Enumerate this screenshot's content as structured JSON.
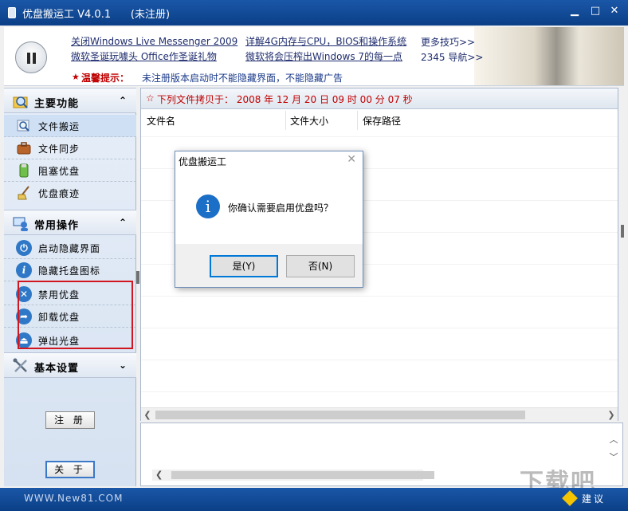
{
  "window": {
    "title": "优盘搬运工 V4.0.1      (未注册)",
    "minimize": "▁",
    "maximize": "□",
    "close": "✕"
  },
  "header": {
    "links": [
      {
        "text": "关闭Windows Live Messenger 2009"
      },
      {
        "text": "微软圣诞玩噱头 Office作圣诞礼物"
      },
      {
        "text": "详解4G内存与CPU，BIOS和操作系统"
      },
      {
        "text": "微软将会压榨出Windows 7的每一点"
      },
      {
        "text": "更多技巧>>"
      },
      {
        "text": "2345 导航>>"
      }
    ],
    "notice_label": "温馨提示：",
    "notice_text": "未注册版本启动时不能隐藏界面，不能隐藏广告"
  },
  "sidebar": {
    "main_functions": {
      "label": "主要功能",
      "chevron": "⌃",
      "items": [
        {
          "label": "文件搬运",
          "icon": "folder-search-icon"
        },
        {
          "label": "文件同步",
          "icon": "briefcase-icon"
        },
        {
          "label": "阻塞优盘",
          "icon": "usb-block-icon"
        },
        {
          "label": "优盘痕迹",
          "icon": "broom-icon"
        }
      ]
    },
    "common_ops": {
      "label": "常用操作",
      "chevron": "⌃",
      "items": [
        {
          "label": "启动隐藏界面",
          "icon": "power-icon"
        },
        {
          "label": "隐藏托盘图标",
          "icon": "info-icon"
        },
        {
          "label": "禁用优盘",
          "icon": "disable-icon"
        },
        {
          "label": "卸载优盘",
          "icon": "unload-icon"
        },
        {
          "label": "弹出光盘",
          "icon": "eject-icon"
        }
      ]
    },
    "basic_settings": {
      "label": "基本设置",
      "chevron": "⌄",
      "icon": "tools-icon"
    },
    "register_button": "注 册",
    "about_button": "关 于"
  },
  "main": {
    "copy_header": "下列文件拷贝于： 2008 年 12 月 20 日 09 时 00 分 07 秒",
    "columns": [
      "文件名",
      "文件大小",
      "保存路径"
    ]
  },
  "dialog": {
    "title": "优盘搬运工",
    "message": "你确认需要启用优盘吗？",
    "yes_button": "是(Y)",
    "no_button": "否(N)",
    "close": "✕",
    "icon_glyph": "i"
  },
  "statusbar": {
    "site": "WWW.New81.COM",
    "suggest": "建议"
  },
  "watermark": "下载吧",
  "colors": {
    "titlebar": "#1a57a8",
    "notice_red": "#c00000",
    "highlight_red": "#d2161f",
    "dialog_default_border": "#0078d7"
  }
}
